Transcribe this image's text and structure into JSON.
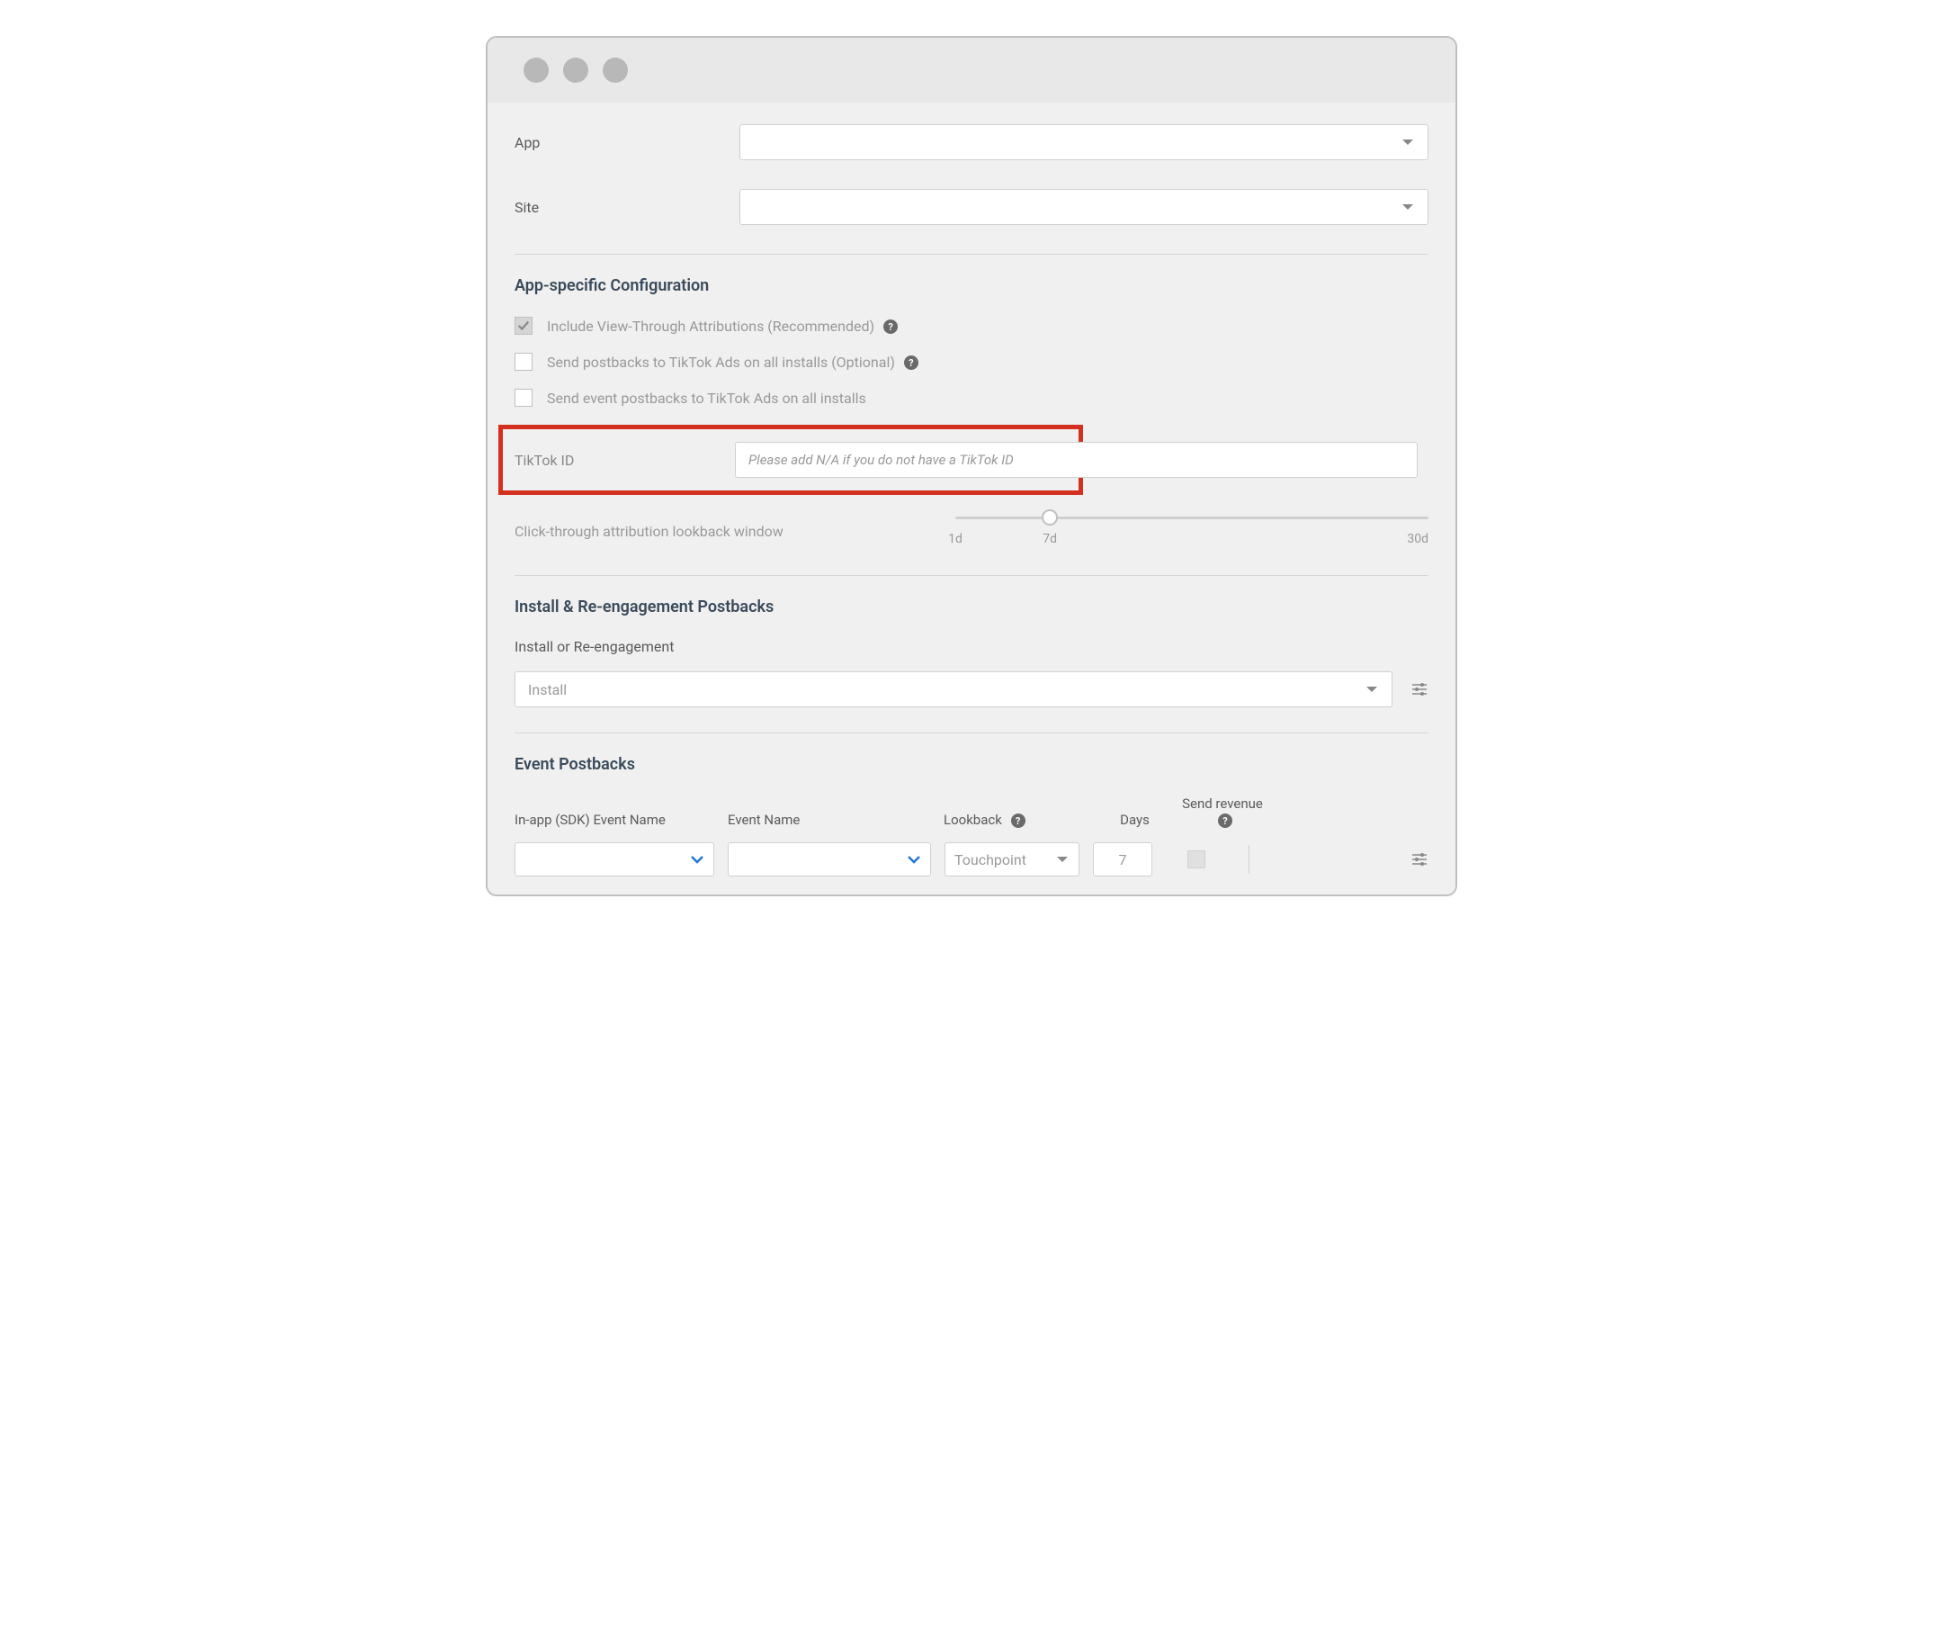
{
  "topForm": {
    "appLabel": "App",
    "appValue": "",
    "siteLabel": "Site",
    "siteValue": ""
  },
  "config": {
    "heading": "App-specific Configuration",
    "checkbox1": {
      "label": "Include View-Through Attributions (Recommended)",
      "checked": true
    },
    "checkbox2": {
      "label": "Send postbacks to TikTok Ads on all installs (Optional)",
      "checked": false
    },
    "checkbox3": {
      "label": "Send event postbacks to TikTok Ads on all installs",
      "checked": false
    },
    "tiktokIdLabel": "TikTok ID",
    "tiktokIdPlaceholder": "Please add N/A if you do not have a TikTok ID",
    "sliderLabel": "Click-through attribution lookback window",
    "sliderTicks": {
      "t1": "1d",
      "t2": "7d",
      "t3": "30d"
    }
  },
  "postbacks": {
    "heading": "Install & Re-engagement Postbacks",
    "subheading": "Install or Re-engagement",
    "selectValue": "Install"
  },
  "events": {
    "heading": "Event Postbacks",
    "columns": {
      "sdk": "In-app (SDK) Event Name",
      "event": "Event Name",
      "lookback": "Lookback",
      "days": "Days",
      "revenue": "Send revenue"
    },
    "row": {
      "sdkValue": "",
      "eventValue": "",
      "lookbackValue": "Touchpoint",
      "daysValue": "7"
    }
  }
}
